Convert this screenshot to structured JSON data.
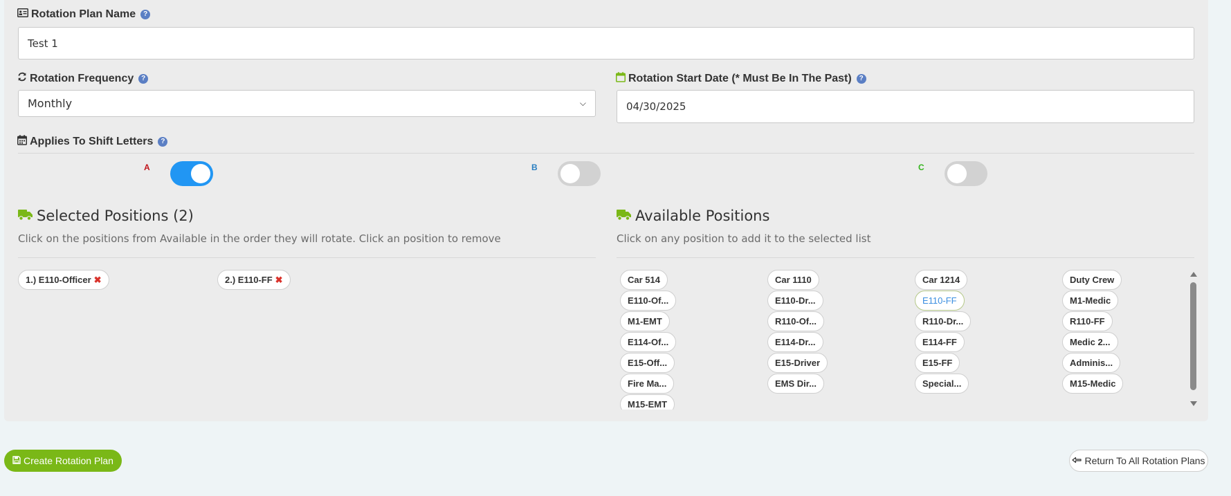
{
  "plan_name": {
    "label": "Rotation Plan Name",
    "value": "Test 1",
    "icon": "id-card-icon"
  },
  "frequency": {
    "label": "Rotation Frequency",
    "selected": "Monthly",
    "icon": "refresh-icon"
  },
  "start_date": {
    "label": "Rotation Start Date (* Must Be In The Past)",
    "value": "04/30/2025",
    "icon": "calendar-icon"
  },
  "shift_letters": {
    "label": "Applies To Shift Letters",
    "icon": "calendar-icon",
    "items": [
      {
        "letter": "A",
        "enabled": true,
        "color": "#c0141b"
      },
      {
        "letter": "B",
        "enabled": false,
        "color": "#2a7fc1"
      },
      {
        "letter": "C",
        "enabled": false,
        "color": "#35b51e"
      }
    ]
  },
  "selected_positions": {
    "title": "Selected Positions (2)",
    "subtitle": "Click on the positions from Available in the order they will rotate. Click an position to remove",
    "icon": "truck-icon",
    "items": [
      "1.) E110-Officer",
      "2.) E110-FF"
    ]
  },
  "available_positions": {
    "title": "Available Positions",
    "subtitle": "Click on any position to add it to the selected list",
    "icon": "truck-icon",
    "items": [
      "Car 514",
      "Car 1110",
      "Car 1214",
      "Duty Crew",
      "E110-Of...",
      "E110-Dr...",
      "E110-FF",
      "M1-Medic",
      "M1-EMT",
      "R110-Of...",
      "R110-Dr...",
      "R110-FF",
      "E114-Of...",
      "E114-Dr...",
      "E114-FF",
      "Medic 2...",
      "E15-Off...",
      "E15-Driver",
      "E15-FF",
      "Adminis...",
      "Fire Ma...",
      "EMS Dir...",
      "Special...",
      "M15-Medic",
      "M15-EMT"
    ],
    "highlighted": "E110-FF"
  },
  "buttons": {
    "create": "Create Rotation Plan",
    "return": "Return To All Rotation Plans"
  },
  "colors": {
    "accent_green": "#7ab817",
    "toggle_on": "#2196f3",
    "help_icon": "#5b7fc4",
    "remove_x": "#d9312a"
  }
}
